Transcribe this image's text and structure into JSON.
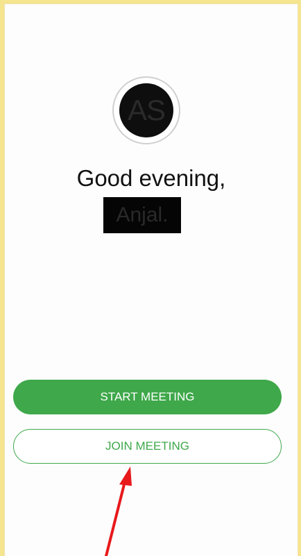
{
  "avatar": {
    "initials": "AS"
  },
  "greeting": {
    "line1": "Good evening,",
    "name": "Anjal."
  },
  "actions": {
    "start_label": "START MEETING",
    "join_label": "JOIN MEETING"
  },
  "colors": {
    "accent": "#3ea84a",
    "frame": "#f6e58f",
    "annotation_arrow": "#e8191b"
  }
}
